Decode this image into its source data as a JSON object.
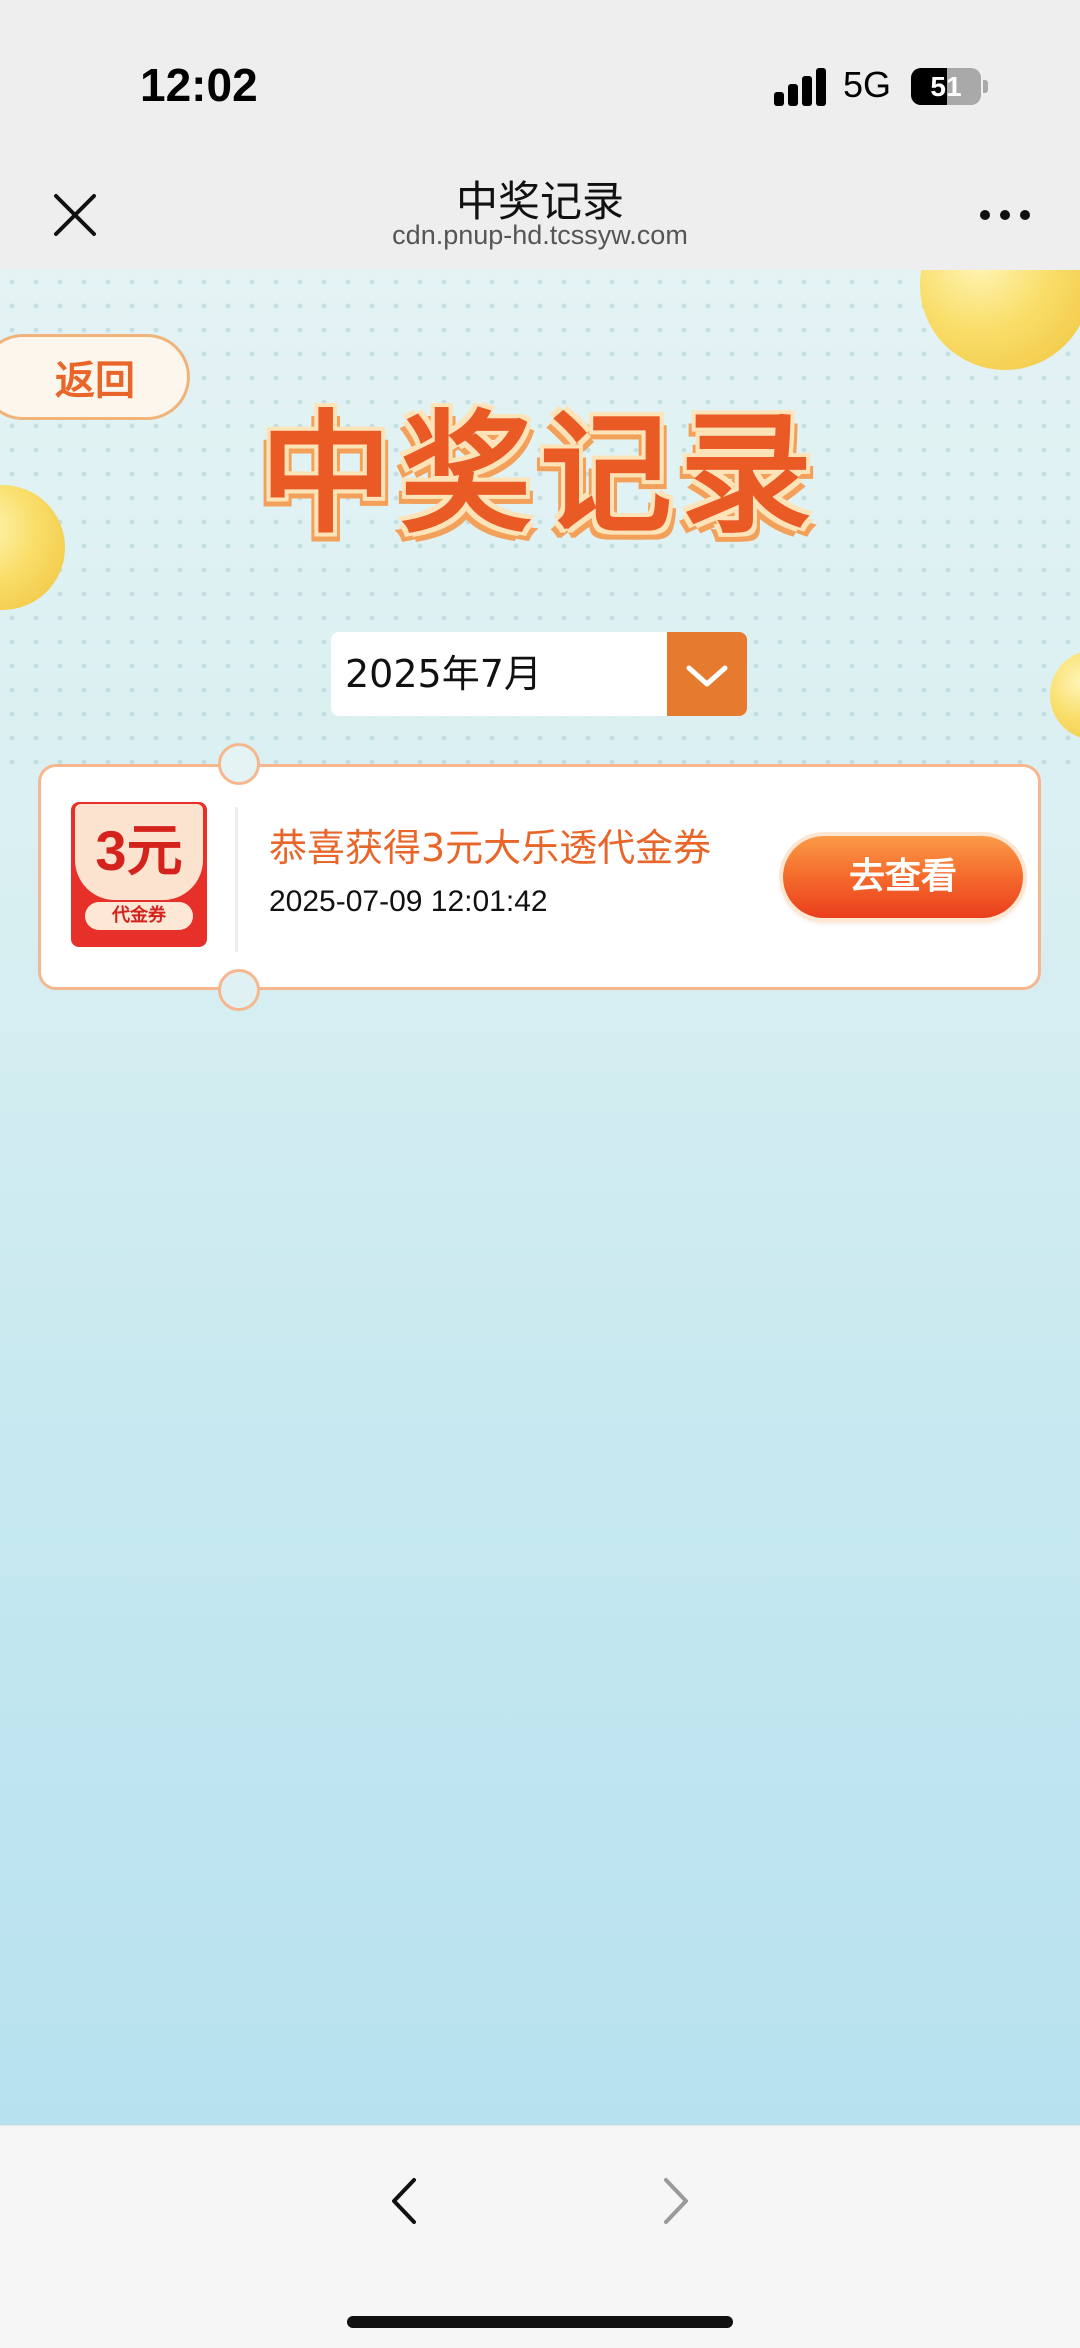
{
  "status_bar": {
    "time": "12:02",
    "network": "5G",
    "battery": "51",
    "battery_level_percent": 51
  },
  "nav": {
    "title": "中奖记录",
    "url": "cdn.pnup-hd.tcssyw.com"
  },
  "page": {
    "back_label": "返回",
    "banner_title": "中奖记录",
    "month_selected": "2025年7月"
  },
  "records": [
    {
      "coupon_value": "3元",
      "coupon_label": "代金券",
      "title": "恭喜获得3元大乐透代金券",
      "time": "2025-07-09 12:01:42",
      "action_label": "去查看"
    }
  ],
  "icons": {
    "close": "close-icon",
    "more": "more-icon",
    "dropdown": "chevron-down-icon",
    "browser_back": "chevron-left-icon",
    "browser_forward": "chevron-right-icon"
  },
  "colors": {
    "accent": "#e8662a",
    "dropdown_bg": "#e67a2e",
    "coupon_red": "#e8302a",
    "card_border": "#f6b78f"
  }
}
